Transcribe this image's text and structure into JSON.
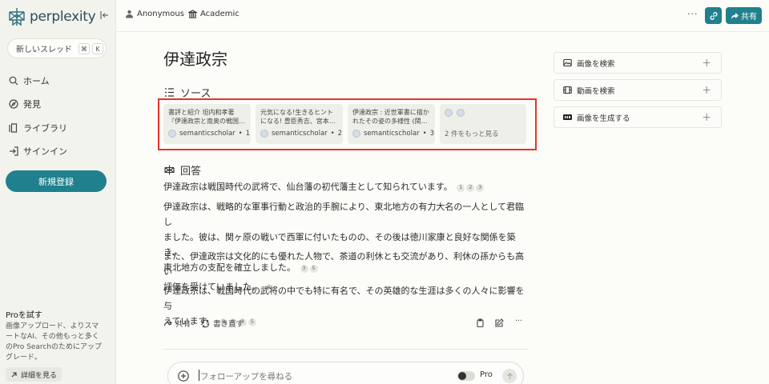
{
  "app": {
    "logo_text": "perplexity"
  },
  "sidebar": {
    "new_thread": "新しいスレッド",
    "shortcut_cmd": "⌘",
    "shortcut_key": "K",
    "items": [
      {
        "label": "ホーム",
        "icon": "search-icon"
      },
      {
        "label": "発見",
        "icon": "compass-icon"
      },
      {
        "label": "ライブラリ",
        "icon": "library-icon"
      },
      {
        "label": "サインイン",
        "icon": "sign-in-icon"
      }
    ],
    "signup_label": "新規登録",
    "pro": {
      "title": "Proを試す",
      "desc": [
        "画像アップロード、よりスマ",
        "ートなAI、その他もっと多く",
        "のPro Searchのためにアップ",
        "グレード。"
      ],
      "link": "詳細を見る"
    }
  },
  "topbar": {
    "user": "Anonymous",
    "focus": "Academic",
    "more": "···",
    "share_label": "共有"
  },
  "main": {
    "title": "伊達政宗",
    "sources_heading": "ソース",
    "sources": [
      {
        "line1": "書評と紹介 坦内和孝著",
        "line2": "『伊達政宗と南奥の戦国…",
        "site": "semanticscholar",
        "num": "1"
      },
      {
        "line1": "元気になる!生きるヒント",
        "line2": "になる! 豊臣秀吉、宮本武…",
        "site": "semanticscholar",
        "num": "2"
      },
      {
        "line1": "伊達政宗 : 近世軍書に描か",
        "line2": "れたその姿の多様性 (関ケ…",
        "site": "semanticscholar",
        "num": "3"
      }
    ],
    "more_sources": "2 件をもっと見る",
    "answer_heading": "回答",
    "paragraphs": [
      {
        "text": "伊達政宗は戦国時代の武将で、仙台藩の初代藩主として知られています。",
        "cites": [
          "1",
          "2",
          "3"
        ]
      },
      {
        "lines": [
          "伊達政宗は、戦略的な軍事行動と政治的手腕により、東北地方の有力大名の一人として君臨し",
          "ました。彼は、関ヶ原の戦いで西軍に付いたものの、その後は徳川家康と良好な関係を築き、",
          "東北地方の支配を確立しました。"
        ],
        "cites": [
          "3",
          "5"
        ]
      },
      {
        "lines": [
          "また、伊達政宗は文化的にも優れた人物で、茶道の利休とも交流があり、利休の孫からも高い",
          "評価を受けていました。"
        ],
        "cites": [
          "4"
        ]
      },
      {
        "lines": [
          "伊達政宗は、戦国時代の武将の中でも特に有名で、その英雄的な生涯は多くの人々に影響を与",
          "えています。"
        ],
        "cites": [
          "1",
          "2",
          "3",
          "5"
        ]
      }
    ],
    "actions": {
      "share": "共有",
      "rewrite": "書き直す",
      "more": "···"
    },
    "follow_up": {
      "placeholder": "フォローアップを尋ねる",
      "pro_label": "Pro"
    }
  },
  "right_panel": {
    "items": [
      {
        "label": "画像を検索",
        "icon": "image-icon"
      },
      {
        "label": "動画を検索",
        "icon": "video-icon"
      },
      {
        "label": "画像を生成する",
        "icon": "pro-badge-icon"
      }
    ]
  }
}
